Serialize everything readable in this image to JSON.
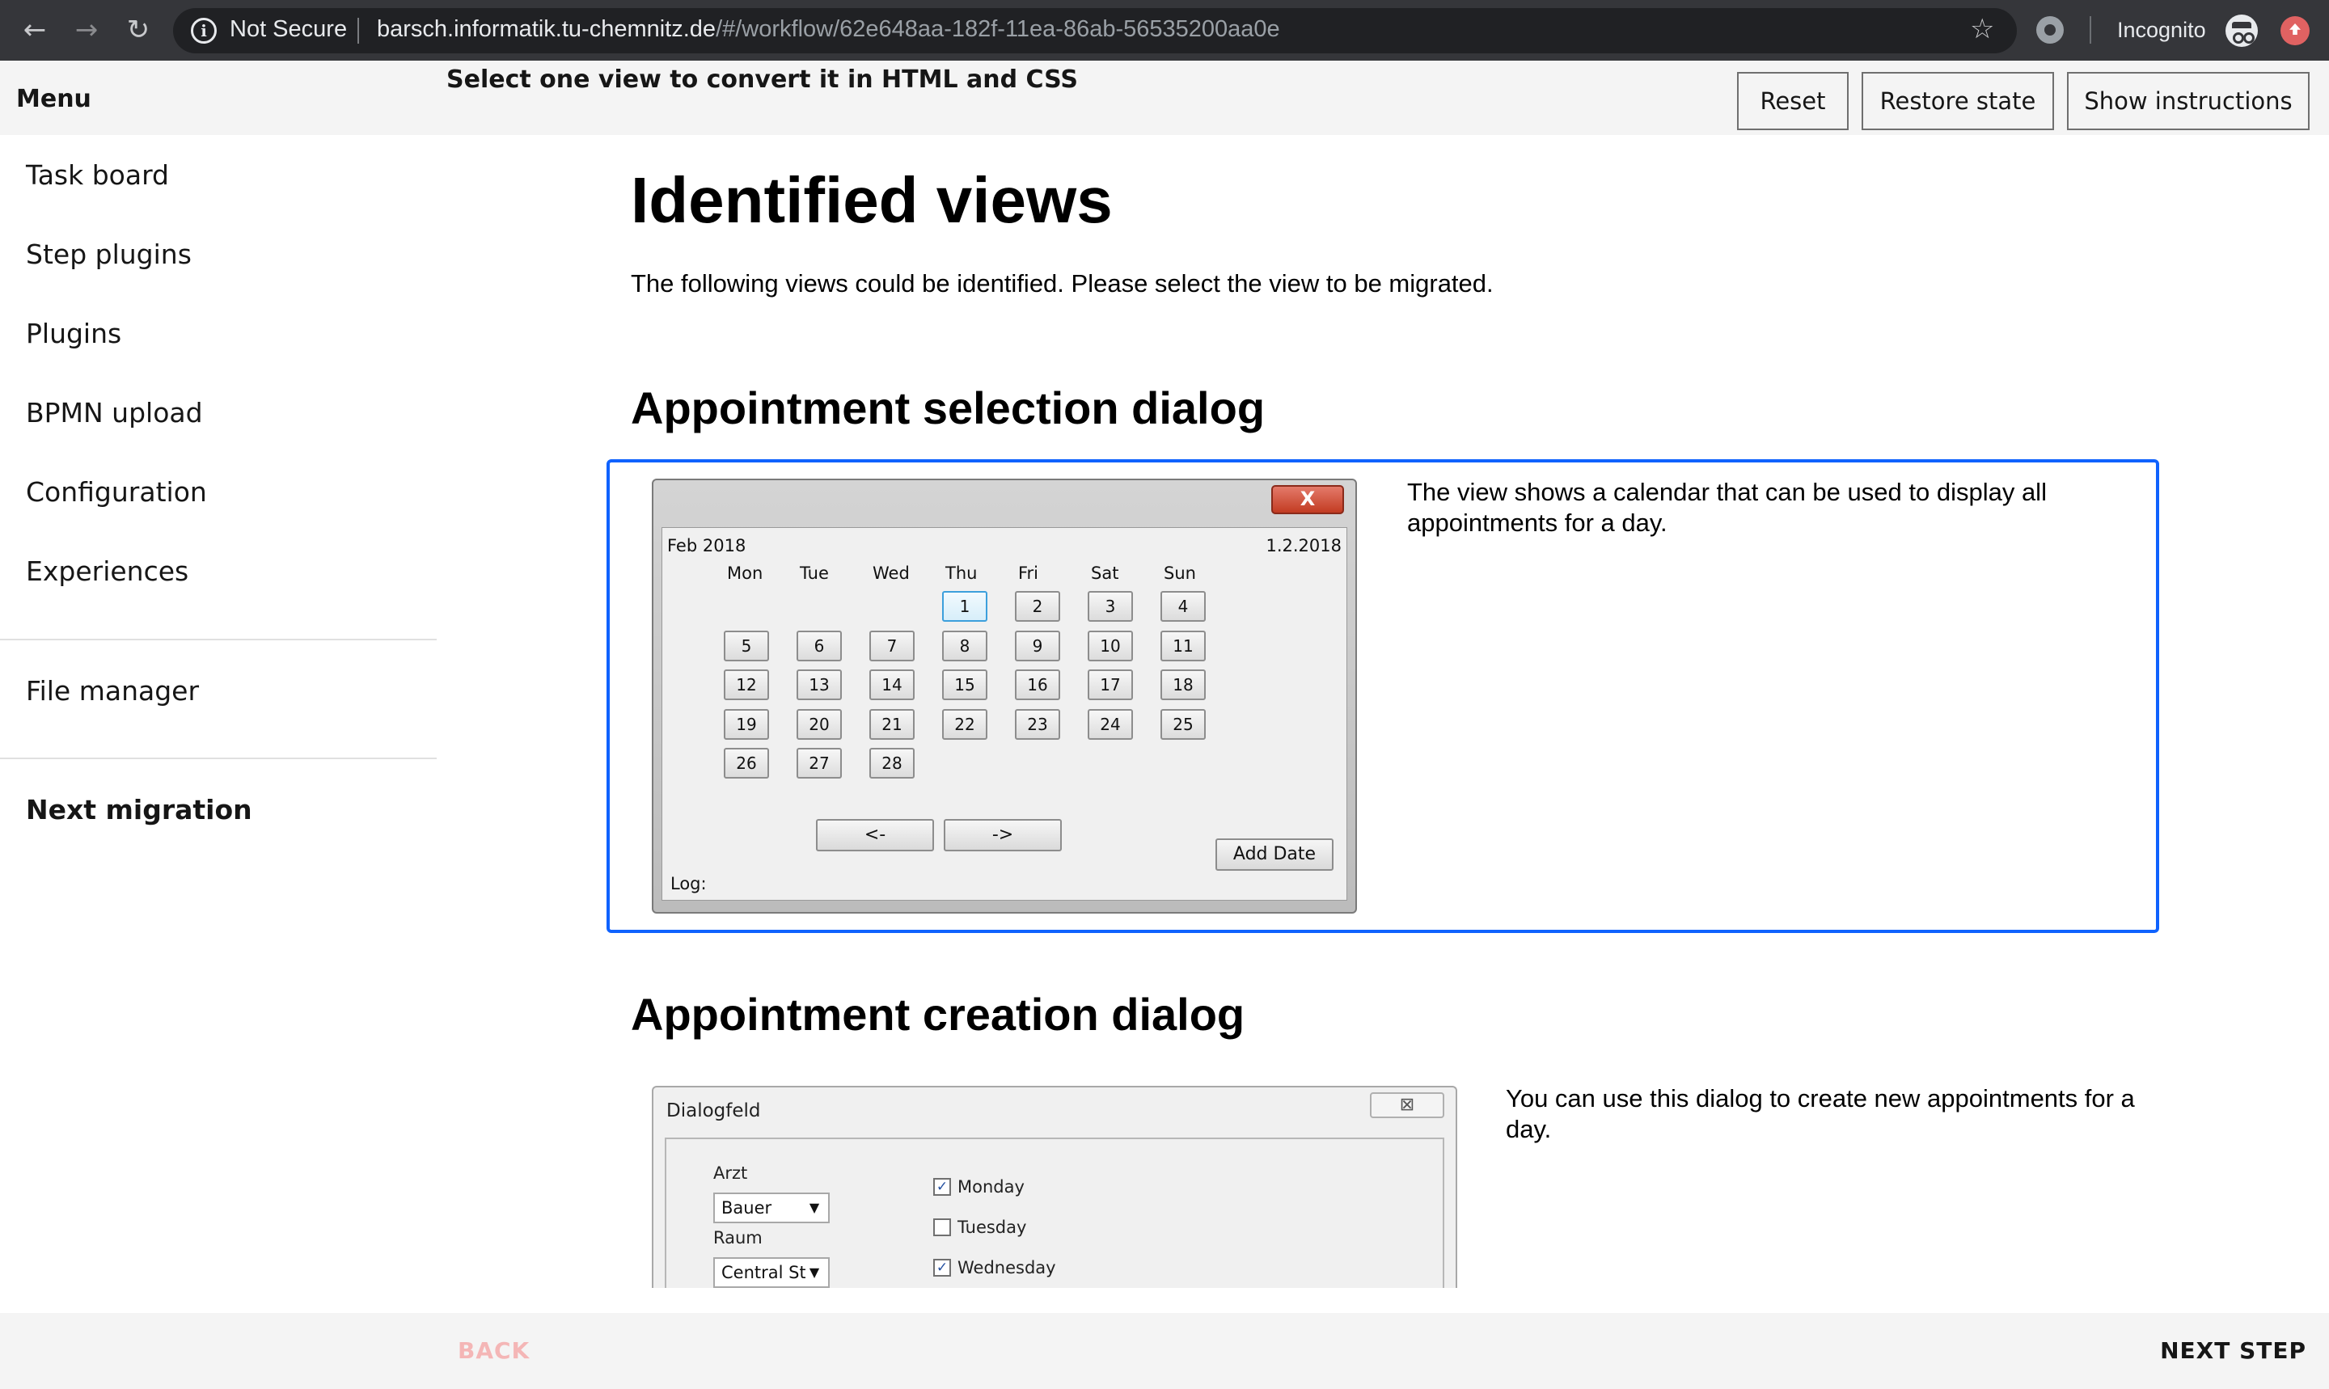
{
  "browser": {
    "security_label": "Not Secure",
    "url_host": "barsch.informatik.tu-chemnitz.de",
    "url_path": "/#/workflow/62e648aa-182f-11ea-86ab-56535200aa0e",
    "incognito_label": "Incognito"
  },
  "header": {
    "menu_title": "Menu",
    "instruction": "Select one view to convert it in HTML and CSS",
    "buttons": {
      "reset": "Reset",
      "restore": "Restore state",
      "instructions": "Show instructions"
    }
  },
  "sidebar": {
    "items": [
      {
        "label": "Task board"
      },
      {
        "label": "Step plugins"
      },
      {
        "label": "Plugins"
      },
      {
        "label": "BPMN upload"
      },
      {
        "label": "Configuration"
      },
      {
        "label": "Experiences"
      }
    ],
    "file_manager": "File manager",
    "next_migration": "Next migration"
  },
  "main": {
    "title": "Identified views",
    "description": "The following views could be identified. Please select the view to be migrated.",
    "views": [
      {
        "title": "Appointment selection dialog",
        "description": "The view shows a calendar that can be used to display all appointments for a day.",
        "selected": true,
        "preview": {
          "close_glyph": "X",
          "month_label": "Feb 2018",
          "date_label": "1.2.2018",
          "weekdays": [
            "Mon",
            "Tue",
            "Wed",
            "Thu",
            "Fri",
            "Sat",
            "Sun"
          ],
          "days": [
            "1",
            "2",
            "3",
            "4",
            "5",
            "6",
            "7",
            "8",
            "9",
            "10",
            "11",
            "12",
            "13",
            "14",
            "15",
            "16",
            "17",
            "18",
            "19",
            "20",
            "21",
            "22",
            "23",
            "24",
            "25",
            "26",
            "27",
            "28"
          ],
          "selected_day": "1",
          "prev_label": "<-",
          "next_label": "->",
          "add_date_label": "Add Date",
          "log_label": "Log:"
        }
      },
      {
        "title": "Appointment creation dialog",
        "description": "You can use this dialog to create new appointments for a day.",
        "selected": false,
        "preview": {
          "window_title": "Dialogfeld",
          "arzt_label": "Arzt",
          "arzt_value": "Bauer",
          "raum_label": "Raum",
          "raum_value": "Central St",
          "checkboxes": [
            {
              "label": "Monday",
              "checked": true
            },
            {
              "label": "Tuesday",
              "checked": false
            },
            {
              "label": "Wednesday",
              "checked": true
            }
          ]
        }
      }
    ]
  },
  "footer": {
    "back": "BACK",
    "next": "NEXT STEP"
  },
  "colors": {
    "selection_border": "#0f62fe",
    "back_disabled": "#f4b6b6"
  },
  "icons": [
    "back-arrow-icon",
    "forward-arrow-icon",
    "reload-icon",
    "info-icon",
    "star-icon",
    "extension-icon",
    "incognito-icon",
    "profile-icon"
  ]
}
